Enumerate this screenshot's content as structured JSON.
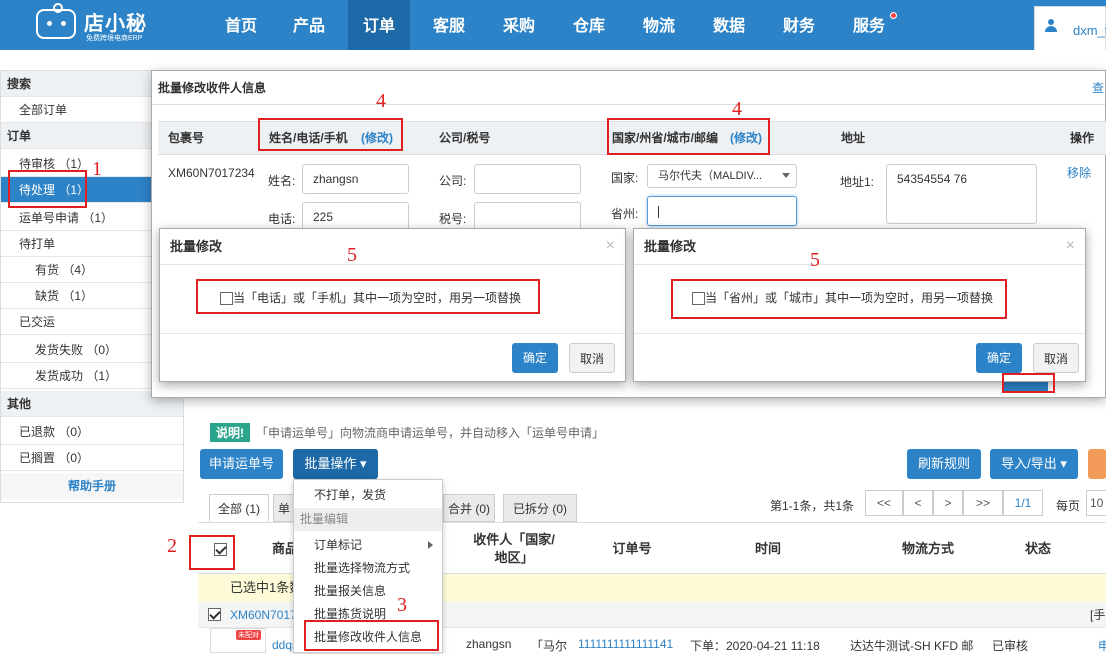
{
  "logo": {
    "name": "店小秘",
    "sub": "免费跨境电商ERP"
  },
  "nav": [
    "首页",
    "产品",
    "订单",
    "客服",
    "采购",
    "仓库",
    "物流",
    "数据",
    "财务",
    "服务"
  ],
  "user": "dxm_t",
  "sidebar": {
    "search": "搜索",
    "all": "全部订单",
    "order": "订单",
    "items": [
      "待审核 （1）",
      "待处理 （1）",
      "运单号申请 （1）",
      "待打单",
      "有货 （4）",
      "缺货 （1）",
      "已交运",
      "发货失败 （0）",
      "发货成功 （1）"
    ],
    "other": "其他",
    "refund": "已退款 （0）",
    "hold": "已搁置 （0）",
    "help": "帮助手册"
  },
  "note": {
    "tag": "说明!",
    "text": "「申请运单号」向物流商申请运单号，并自动移入「运单号申请」"
  },
  "buttons": {
    "apply": "申请运单号",
    "batch": "批量操作 ▾",
    "refresh": "刷新规则",
    "import": "导入/导出 ▾"
  },
  "tabs": [
    "全部 (1)",
    "单",
    "合并 (0)",
    "已拆分 (0)"
  ],
  "pager": {
    "info": "第1-1条，共1条",
    "first": "<<",
    "prev": "<",
    "next": ">",
    "last": ">>",
    "page": "1/1",
    "per": "每页",
    "per_val": "10"
  },
  "table": {
    "headers": [
      "商品",
      "收件人「国家/地区」",
      "订单号",
      "时间",
      "物流方式",
      "状态"
    ]
  },
  "selected": "已选中1条数",
  "order": {
    "no": "XM60N7017",
    "flag": "[手",
    "badge": "未配对",
    "sku": "ddqs",
    "recipient": "zhangsn",
    "country": "「马尔",
    "number": "1111111111111141",
    "time": "下单：2020-04-21 11:18",
    "logistics": "达达牛测试-SH KFD 邮",
    "status": "已审核",
    "extra": "申"
  },
  "dropdown": {
    "items": [
      "不打单，发货",
      "批量编辑",
      "订单标记",
      "批量选择物流方式",
      "批量报关信息",
      "批量拣货说明",
      "批量修改收件人信息"
    ]
  },
  "modal": {
    "title": "批量修改收件人信息",
    "headers": [
      "包裹号",
      "姓名/电话/手机",
      "(修改)",
      "公司/税号",
      "国家/州省/城市/邮编",
      "(修改)",
      "地址",
      "操作"
    ],
    "pkg": "XM60N7017234",
    "name_label": "姓名:",
    "name": "zhangsn",
    "phone_label": "电话:",
    "phone": "225",
    "company_label": "公司:",
    "tax_label": "税号:",
    "country_label": "国家:",
    "country": "马尔代夫（MALDIV...",
    "province_label": "省州:",
    "addr_label": "地址1:",
    "addr": "54354554 76",
    "remove": "移除",
    "trunc": "查"
  },
  "dialogs": [
    {
      "title": "批量修改",
      "text": "当「电话」或「手机」其中一项为空时，用另一项替换",
      "ok": "确定",
      "cancel": "取消"
    },
    {
      "title": "批量修改",
      "text": "当「省州」或「城市」其中一项为空时，用另一项替换",
      "ok": "确定",
      "cancel": "取消"
    }
  ],
  "annotations": [
    "1",
    "2",
    "3",
    "4",
    "4",
    "5",
    "5"
  ],
  "colors": {
    "primary": "#2d83c7",
    "annotation": "#e02020",
    "active_nav": "#1d68a6"
  }
}
